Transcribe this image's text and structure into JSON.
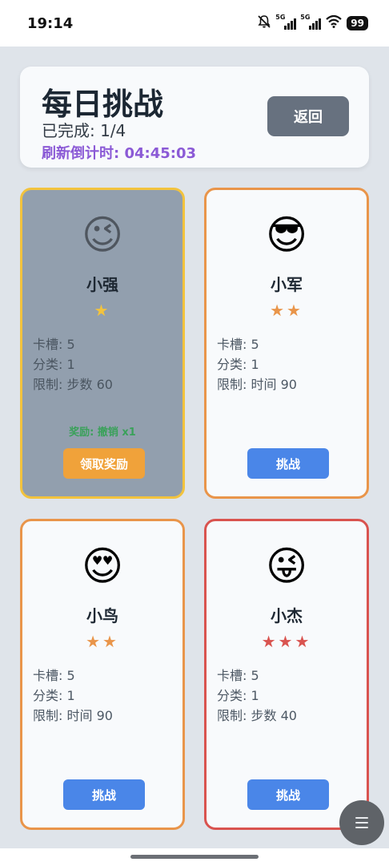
{
  "status_bar": {
    "time": "19:14",
    "network_1": "5G",
    "network_2": "5G",
    "battery": "99"
  },
  "header": {
    "title": "每日挑战",
    "progress": "已完成: 1/4",
    "countdown": "刷新倒计时: 04:45:03",
    "back_label": "返回"
  },
  "cards": [
    {
      "emoji": "😉",
      "name": "小强",
      "stars": "★",
      "star_color": "#f2c33e",
      "slots": "卡槽: 5",
      "category": "分类: 1",
      "limit": "限制: 步数 60",
      "reward": "奖励: 撤销 x1",
      "claim_label": "领取奖励",
      "state": "completed"
    },
    {
      "emoji": "😎",
      "name": "小军",
      "stars": "★★",
      "star_color": "#e9954a",
      "slots": "卡槽: 5",
      "category": "分类: 1",
      "limit": "限制: 时间 90",
      "challenge_label": "挑战",
      "state": "open"
    },
    {
      "emoji": "😍",
      "name": "小鸟",
      "stars": "★★",
      "star_color": "#e9954a",
      "slots": "卡槽: 5",
      "category": "分类: 1",
      "limit": "限制: 时间 90",
      "challenge_label": "挑战",
      "state": "open"
    },
    {
      "emoji": "😜",
      "name": "小杰",
      "stars": "★★★",
      "star_color": "#d9534f",
      "slots": "卡槽: 5",
      "category": "分类: 1",
      "limit": "限制: 步数 40",
      "challenge_label": "挑战",
      "state": "open"
    }
  ],
  "colors": {
    "accent_purple": "#8b5ad6",
    "button_blue": "#4a86e8",
    "button_orange": "#f0a23a",
    "reward_green": "#3aa15a"
  },
  "icons": {
    "mute": "bell-off-icon",
    "signal": "signal-icon",
    "wifi": "wifi-icon",
    "battery": "battery-icon",
    "fab": "menu-icon"
  }
}
